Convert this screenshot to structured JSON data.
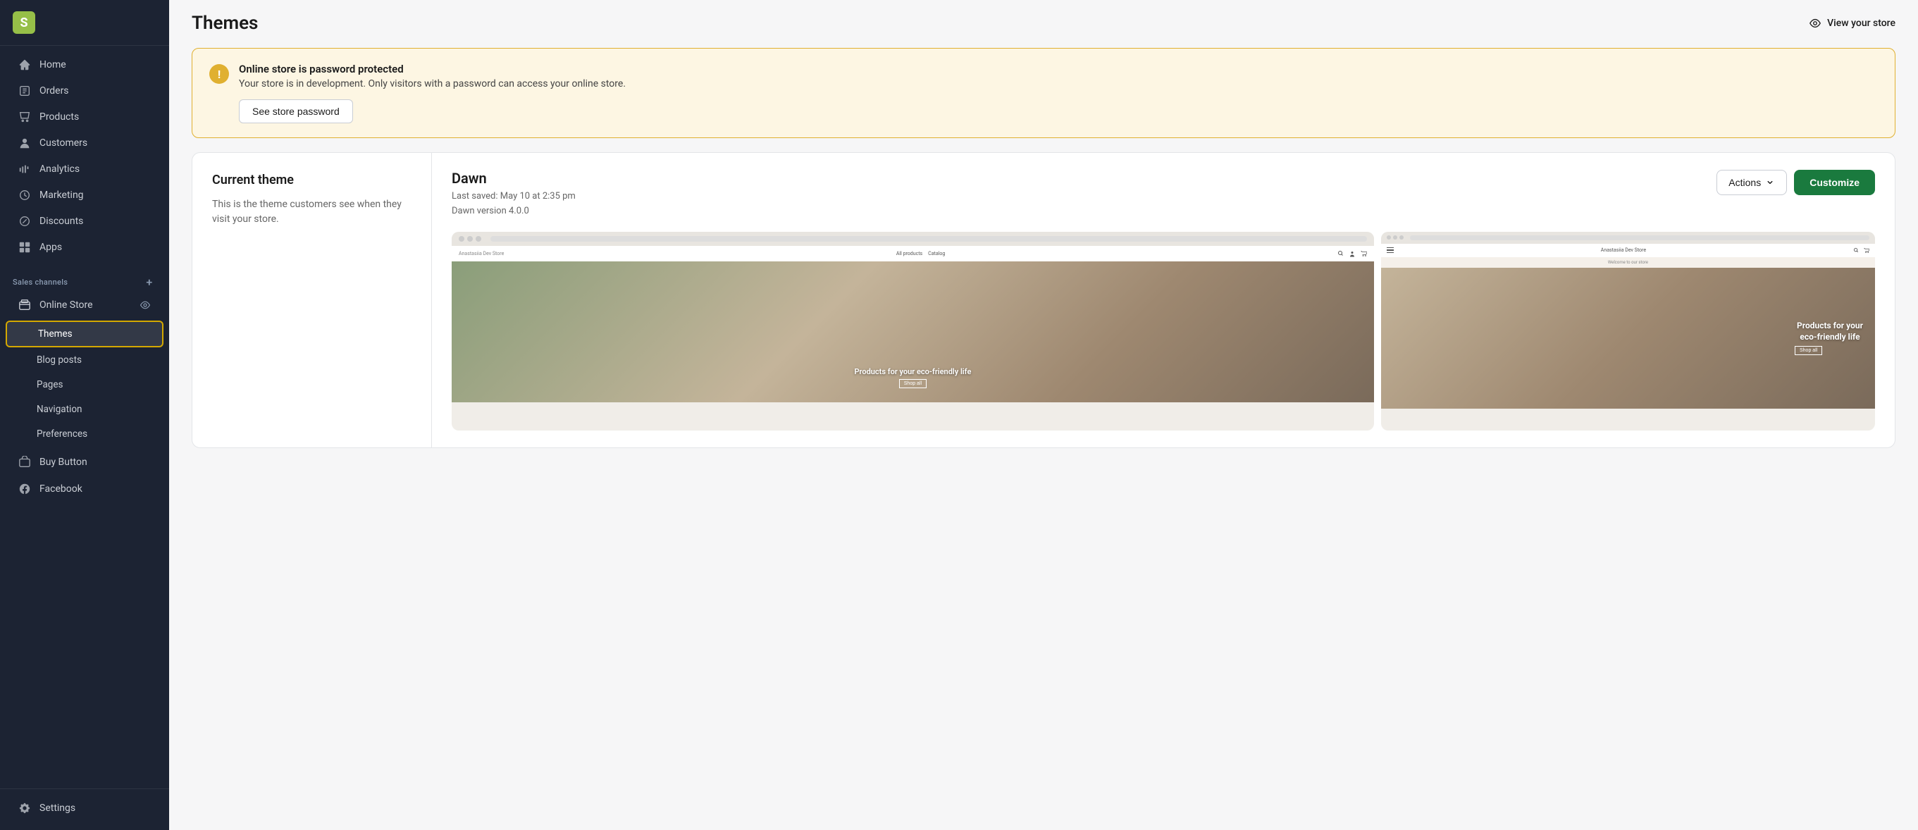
{
  "sidebar": {
    "nav_items": [
      {
        "id": "home",
        "label": "Home",
        "icon": "home"
      },
      {
        "id": "orders",
        "label": "Orders",
        "icon": "orders"
      },
      {
        "id": "products",
        "label": "Products",
        "icon": "products"
      },
      {
        "id": "customers",
        "label": "Customers",
        "icon": "customers"
      },
      {
        "id": "analytics",
        "label": "Analytics",
        "icon": "analytics"
      },
      {
        "id": "marketing",
        "label": "Marketing",
        "icon": "marketing"
      },
      {
        "id": "discounts",
        "label": "Discounts",
        "icon": "discounts"
      },
      {
        "id": "apps",
        "label": "Apps",
        "icon": "apps"
      }
    ],
    "sales_channels_label": "Sales channels",
    "online_store_label": "Online Store",
    "sub_items": [
      {
        "id": "themes",
        "label": "Themes",
        "active": true
      },
      {
        "id": "blog-posts",
        "label": "Blog posts"
      },
      {
        "id": "pages",
        "label": "Pages"
      },
      {
        "id": "navigation",
        "label": "Navigation"
      },
      {
        "id": "preferences",
        "label": "Preferences"
      }
    ],
    "other_channels": [
      {
        "id": "buy-button",
        "label": "Buy Button",
        "icon": "buy-button"
      },
      {
        "id": "facebook",
        "label": "Facebook",
        "icon": "facebook"
      }
    ],
    "settings_label": "Settings"
  },
  "header": {
    "title": "Themes",
    "view_store_label": "View your store"
  },
  "alert": {
    "title": "Online store is password protected",
    "description": "Your store is in development. Only visitors with a password can access your online store.",
    "button_label": "See store password"
  },
  "current_theme": {
    "section_label": "Current theme",
    "description": "This is the theme customers see when they visit your store."
  },
  "theme": {
    "name": "Dawn",
    "last_saved": "Last saved: May 10 at 2:35 pm",
    "version": "Dawn version 4.0.0",
    "actions_label": "Actions",
    "customize_label": "Customize",
    "preview_store_name": "Anastasiia Dev Store",
    "preview_nav_items": [
      "All products",
      "Catalog"
    ],
    "preview_hero_text": "Products for your eco-friendly life",
    "preview_shop_all": "Shop all",
    "mobile_hero_title": "Products for your eco-friendly life",
    "mobile_store_name": "Anastasiia Dev Store",
    "mobile_shop_all": "Shop all",
    "welcome_text": "Welcome to our store"
  },
  "colors": {
    "sidebar_bg": "#1c2333",
    "sidebar_text": "#c9cdd4",
    "active_border": "#d4a800",
    "customize_green": "#1a7a3e",
    "alert_bg": "#fdf6e3",
    "alert_border": "#e0b030",
    "alert_icon": "#e0b030"
  }
}
